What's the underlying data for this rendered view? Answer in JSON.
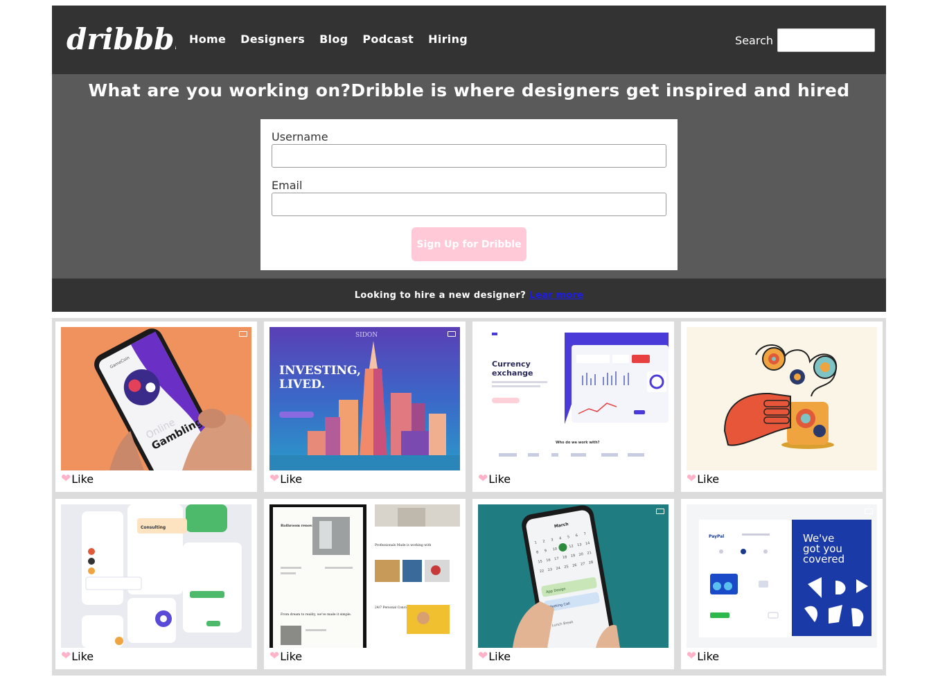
{
  "header": {
    "logo_text": "dribbble",
    "nav": [
      "Home",
      "Designers",
      "Blog",
      "Podcast",
      "Hiring"
    ],
    "search_label": "Search",
    "search_value": ""
  },
  "hero": {
    "title": "What are you working on?Dribble is where designers get inspired and hired",
    "username_label": "Username",
    "username_value": "",
    "email_label": "Email",
    "email_value": "",
    "signup_button": "Sign Up for Dribble"
  },
  "hire_bar": {
    "text": "Looking to hire a new designer?",
    "link": "Lear more"
  },
  "colors": {
    "header_bg": "#333333",
    "hero_bg": "#5a5a5a",
    "button_bg": "#ffc9d8",
    "heart": "#ffb3c8",
    "link": "#1a1aee"
  },
  "shots": [
    {
      "like_label": "Like",
      "thumb_texts": [
        "GameCoin",
        "Online",
        "Gambling"
      ]
    },
    {
      "like_label": "Like",
      "thumb_texts": [
        "SIDON",
        "INVESTING,",
        "LIVED."
      ]
    },
    {
      "like_label": "Like",
      "thumb_texts": [
        "Currency",
        "exchange",
        "Who do we work with?"
      ]
    },
    {
      "like_label": "Like",
      "thumb_texts": []
    },
    {
      "like_label": "Like",
      "thumb_texts": [
        "Consulting"
      ]
    },
    {
      "like_label": "Like",
      "thumb_texts": [
        "Bathroom renovations, made easy.",
        "Professionals Made is working with",
        "24/7 Personal Concierge",
        "From dream to reality, we've made it simple."
      ]
    },
    {
      "like_label": "Like",
      "thumb_texts": [
        "March",
        "App Design",
        "Meeting Call",
        "Lunch Break"
      ]
    },
    {
      "like_label": "Like",
      "thumb_texts": [
        "PayPal",
        "We've",
        "got you",
        "covered"
      ]
    }
  ]
}
